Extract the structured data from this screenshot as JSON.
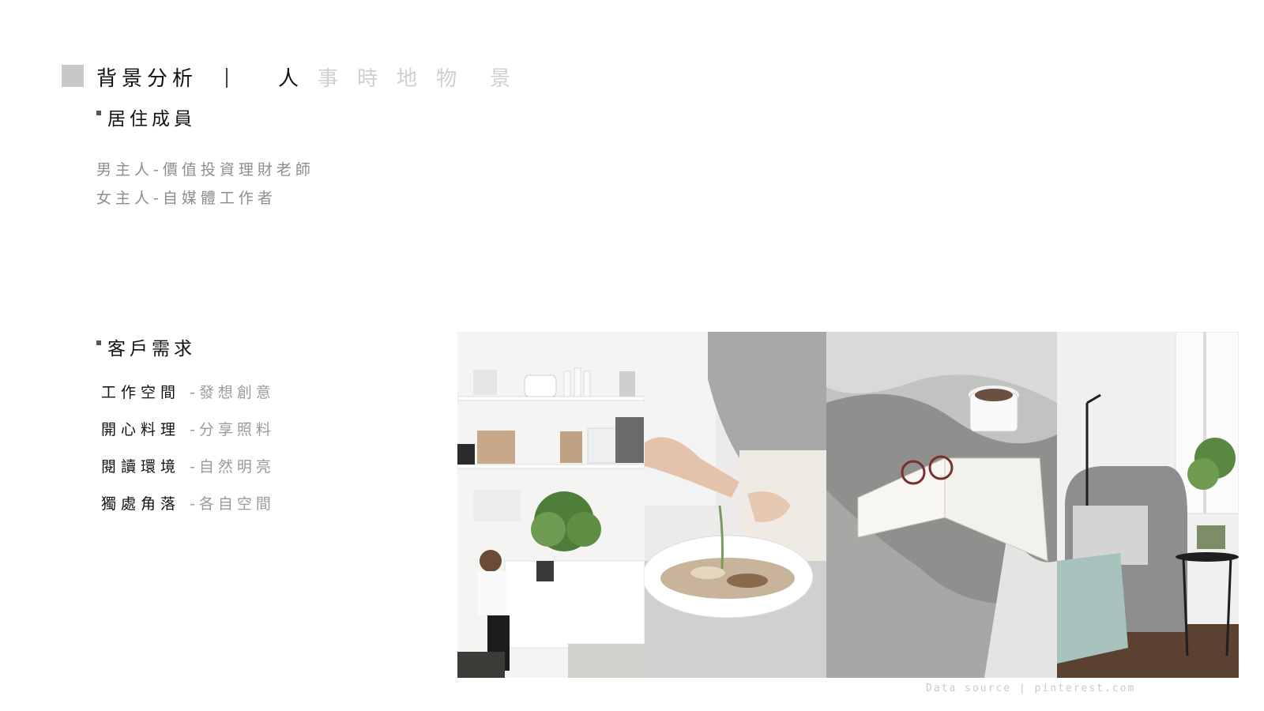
{
  "header": {
    "title": "背景分析",
    "divider": "|",
    "nav": [
      "人",
      "事",
      "時",
      "地",
      "物",
      "景"
    ],
    "active_index": 0
  },
  "members": {
    "heading": "居住成員",
    "lines": [
      "男主人-價值投資理財老師",
      "女主人-自媒體工作者"
    ]
  },
  "needs": {
    "heading": "客戶需求",
    "items": [
      {
        "label": "工作空間",
        "desc": "-發想創意"
      },
      {
        "label": "開心料理",
        "desc": "-分享照料"
      },
      {
        "label": "閱讀環境",
        "desc": "-自然明亮"
      },
      {
        "label": "獨處角落",
        "desc": "-各自空間"
      }
    ]
  },
  "footer": {
    "source": "Data source | pinterest.com"
  },
  "colors": {
    "accent_square": "#c8c8c8",
    "inactive_nav": "#cfcfcf",
    "muted_text": "#8e8e8e"
  }
}
